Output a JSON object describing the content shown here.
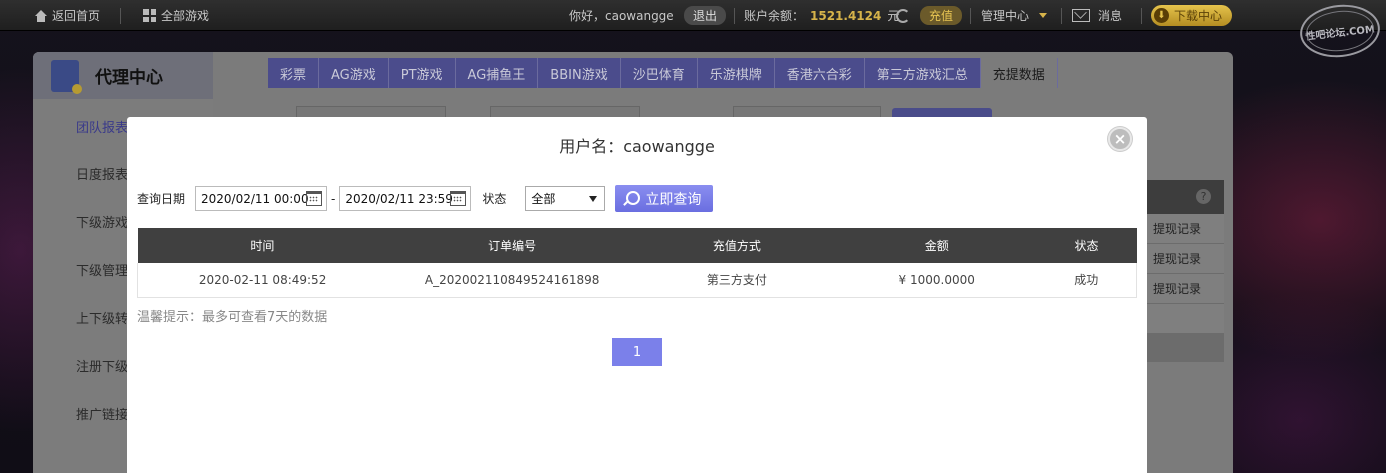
{
  "topbar": {
    "home_label": "返回首页",
    "games_label": "全部游戏",
    "greeting": "你好，caowangge",
    "logout_label": "退出",
    "balance_label": "账户余额：",
    "balance_value": "1521.4124",
    "balance_unit": "元",
    "recharge_label": "充值",
    "manage_label": "管理中心",
    "message_label": "消息",
    "download_label": "下载中心",
    "accent_color": "#d6b34a"
  },
  "watermark": {
    "text": "性吧论坛.COM"
  },
  "panel": {
    "title": "代理中心",
    "sidebar": [
      {
        "label": "团队报表"
      },
      {
        "label": "日度报表"
      },
      {
        "label": "下级游戏"
      },
      {
        "label": "下级管理"
      },
      {
        "label": "上下级转"
      },
      {
        "label": "注册下级"
      },
      {
        "label": "推广链接"
      }
    ],
    "tabs": [
      {
        "label": "彩票"
      },
      {
        "label": "AG游戏"
      },
      {
        "label": "PT游戏"
      },
      {
        "label": "AG捕鱼王"
      },
      {
        "label": "BBIN游戏"
      },
      {
        "label": "沙巴体育"
      },
      {
        "label": "乐游棋牌"
      },
      {
        "label": "香港六合彩"
      },
      {
        "label": "第三方游戏汇总"
      },
      {
        "label": "充提数据"
      }
    ],
    "right_rows": [
      {
        "label": "提现记录"
      },
      {
        "label": "提现记录"
      },
      {
        "label": "提现记录"
      }
    ]
  },
  "modal": {
    "title": "用户名：caowangge",
    "date_label": "查询日期",
    "date_from": "2020/02/11 00:00",
    "date_sep": "-",
    "date_to": "2020/02/11 23:59",
    "status_label": "状态",
    "status_value": "全部",
    "query_label": "立即查询",
    "columns": [
      "时间",
      "订单编号",
      "充值方式",
      "金额",
      "状态"
    ],
    "rows": [
      {
        "time": "2020-02-11 08:49:52",
        "order_no": "A_202002110849524161898",
        "method": "第三方支付",
        "amount": "¥ 1000.0000",
        "status": "成功"
      }
    ],
    "tip": "温馨提示：最多可查看7天的数据",
    "page": "1",
    "accent_color": "#7b80ea"
  }
}
